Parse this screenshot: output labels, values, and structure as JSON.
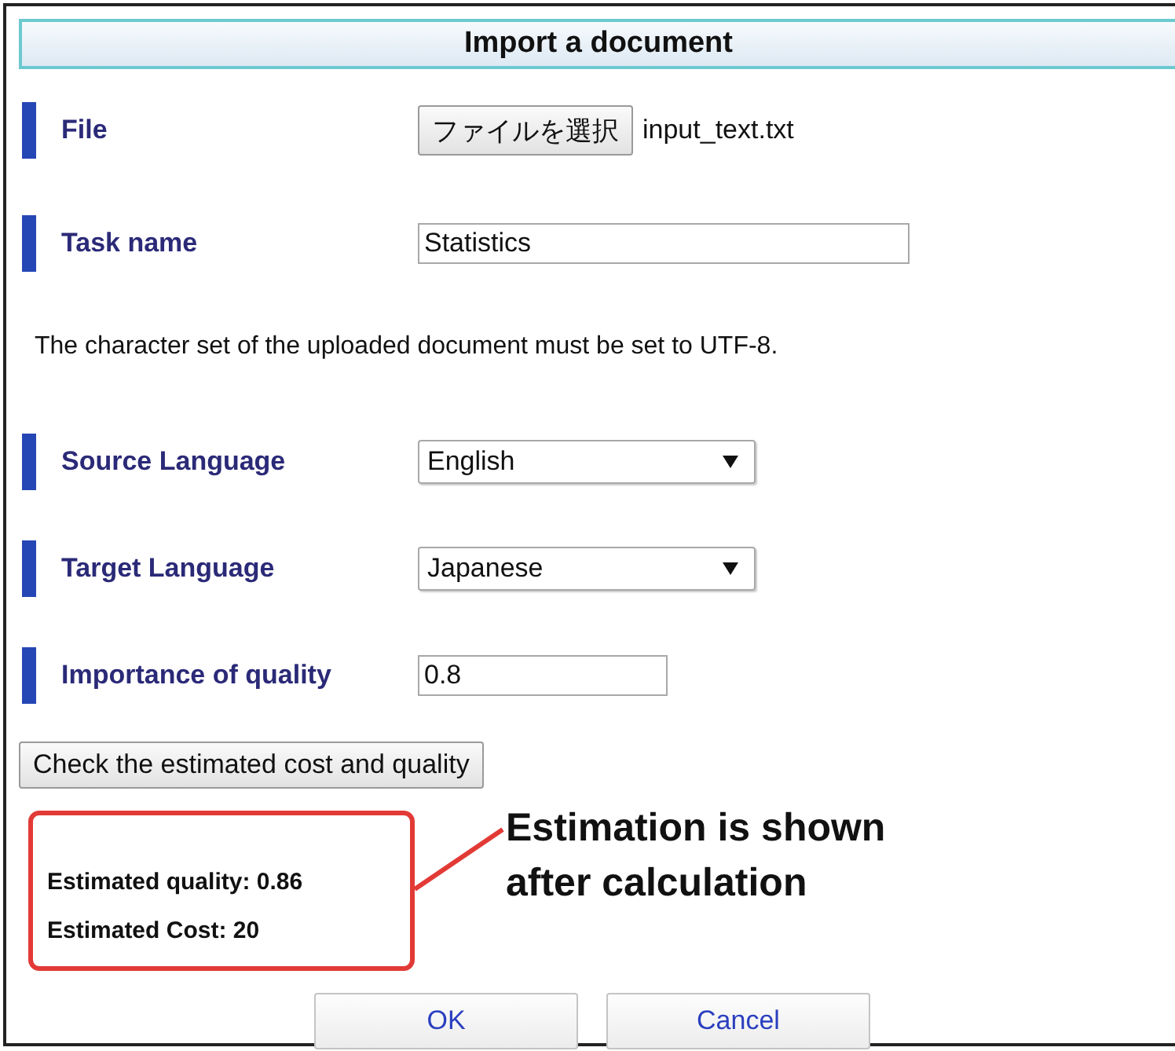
{
  "dialog": {
    "title": "Import a document"
  },
  "fields": [
    {
      "kind": "file",
      "label": "File",
      "button": "ファイルを選択",
      "value": "input_text.txt"
    },
    {
      "kind": "text",
      "label": "Task name",
      "value": "Statistics"
    },
    {
      "kind": "note",
      "text": "The character set of the uploaded document must be set to UTF-8."
    },
    {
      "kind": "select",
      "label": "Source Language",
      "value": "English"
    },
    {
      "kind": "select",
      "label": "Target Language",
      "value": "Japanese"
    },
    {
      "kind": "short",
      "label": "Importance of quality",
      "value": "0.8"
    }
  ],
  "check_button": "Check the estimated cost and quality",
  "estimates": [
    "Estimated quality: 0.86",
    "Estimated Cost: 20"
  ],
  "annotation": "Estimation is shown after calculation",
  "buttons": [
    "OK",
    "Cancel"
  ]
}
